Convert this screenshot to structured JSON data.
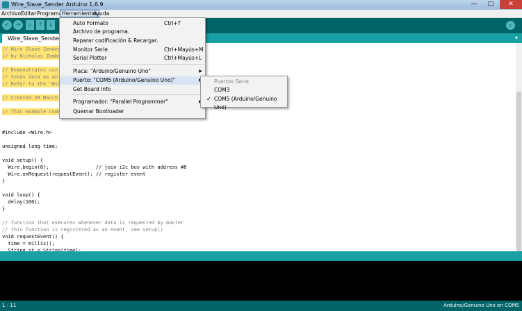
{
  "window": {
    "title": "Wire_Slave_Sender Arduino 1.6.9",
    "min": "—",
    "max": "□",
    "close": "✕"
  },
  "menubar": [
    "Archivo",
    "Editar",
    "Programa",
    "Herramientas",
    "Ayuda"
  ],
  "toolbar": {
    "verify": "✓",
    "upload": "→",
    "new": "▫",
    "open": "↑",
    "save": "↓",
    "serial_monitor": "⌕"
  },
  "tab": {
    "name": "Wire_Slave_Sender",
    "menu": "▾"
  },
  "code_lines": [
    {
      "text": "// Wire Slave Sender",
      "hl": true
    },
    {
      "text": "// by Nicholas Zambe",
      "hl": true
    },
    {
      "text": "",
      "hl": true
    },
    {
      "text": "// Demonstrates use",
      "hl": true
    },
    {
      "text": "// Sends data as an",
      "hl": true
    },
    {
      "text": "// Refer to the \"Wir",
      "hl": true
    },
    {
      "text": "",
      "hl": true
    },
    {
      "text": "// Created 29 March",
      "hl": true
    },
    {
      "text": "",
      "hl": true
    },
    {
      "text": "// This example code",
      "hl": true
    },
    {
      "text": "",
      "hl": false
    },
    {
      "text": "",
      "hl": false
    },
    {
      "text": "#include <Wire.h>",
      "hl": false
    },
    {
      "text": "",
      "hl": false
    },
    {
      "text": "unsigned long time;",
      "hl": false
    },
    {
      "text": "",
      "hl": false
    },
    {
      "text": "void setup() {",
      "hl": false
    },
    {
      "text": "  Wire.begin(8);                // join i2c bus with address #8",
      "hl": false
    },
    {
      "text": "  Wire.onRequest(requestEvent); // register event",
      "hl": false
    },
    {
      "text": "}",
      "hl": false
    },
    {
      "text": "",
      "hl": false
    },
    {
      "text": "void loop() {",
      "hl": false
    },
    {
      "text": "  delay(100);",
      "hl": false
    },
    {
      "text": "}",
      "hl": false
    },
    {
      "text": "",
      "hl": false
    },
    {
      "text": "// function that executes whenever data is requested by master",
      "hl": false
    },
    {
      "text": "// this function is registered as an event, see setup()",
      "hl": false
    },
    {
      "text": "void requestEvent() {",
      "hl": false
    },
    {
      "text": "  time = millis();",
      "hl": false
    },
    {
      "text": "  String st = String(time);",
      "hl": false
    }
  ],
  "tools_menu": [
    {
      "label": "Auto Formato",
      "shortcut": "Ctrl+T"
    },
    {
      "label": "Archivo de programa.",
      "shortcut": ""
    },
    {
      "label": "Reparar codificación & Recargar.",
      "shortcut": ""
    },
    {
      "label": "Monitor Serie",
      "shortcut": "Ctrl+Mayús+M"
    },
    {
      "label": "Serial Plotter",
      "shortcut": "Ctrl+Mayús+L"
    },
    {
      "label": "Placa: \"Arduino/Genuino Uno\"",
      "shortcut": "",
      "submenu": true
    },
    {
      "label": "Puerto: \"COM5 (Arduino/Genuino Uno)\"",
      "shortcut": "",
      "submenu": true,
      "hover": true
    },
    {
      "label": "Get Board Info",
      "shortcut": ""
    },
    {
      "label": "Programador: \"Parallel Programmer\"",
      "shortcut": "",
      "submenu": true
    },
    {
      "label": "Quemar Bootloader",
      "shortcut": ""
    }
  ],
  "port_menu": {
    "header": "Puertos Serie",
    "items": [
      {
        "label": "COM3",
        "checked": false
      },
      {
        "label": "COM5 (Arduino/Genuino Uno)",
        "checked": true
      }
    ],
    "check": "✓"
  },
  "status": {
    "line": "1 - 11",
    "board": "Arduino/Genuino Uno en COM5"
  }
}
